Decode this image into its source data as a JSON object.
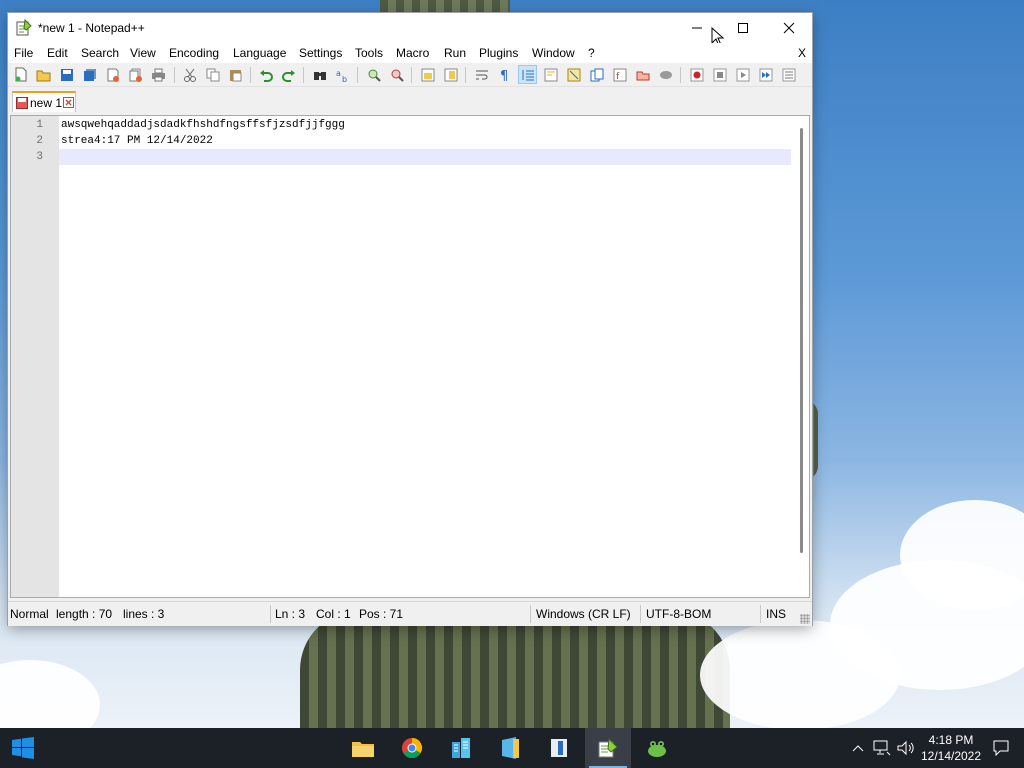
{
  "window": {
    "title": "*new 1 - Notepad++",
    "menu": [
      "File",
      "Edit",
      "Search",
      "View",
      "Encoding",
      "Language",
      "Settings",
      "Tools",
      "Macro",
      "Run",
      "Plugins",
      "Window",
      "?"
    ],
    "menu_close": "X"
  },
  "tabs": [
    {
      "label": "new 1",
      "modified": true
    }
  ],
  "editor": {
    "lines": [
      "awsqwehqaddadjsdadkfhshdfngsffsfjzsdfjjfggg",
      "strea4:17 PM 12/14/2022",
      ""
    ],
    "line_numbers": [
      "1",
      "2",
      "3"
    ]
  },
  "status": {
    "mode": "Normal",
    "length": "length : 70",
    "lines": "lines : 3",
    "ln": "Ln : 3",
    "col": "Col : 1",
    "pos": "Pos : 71",
    "eol": "Windows (CR LF)",
    "encoding": "UTF-8-BOM",
    "insert": "INS"
  },
  "taskbar": {
    "time": "4:18 PM",
    "date": "12/14/2022"
  },
  "colors": {
    "accent_tab": "#f39c1f",
    "current_line": "#e8e8ff",
    "taskbar": "#1c2027"
  }
}
